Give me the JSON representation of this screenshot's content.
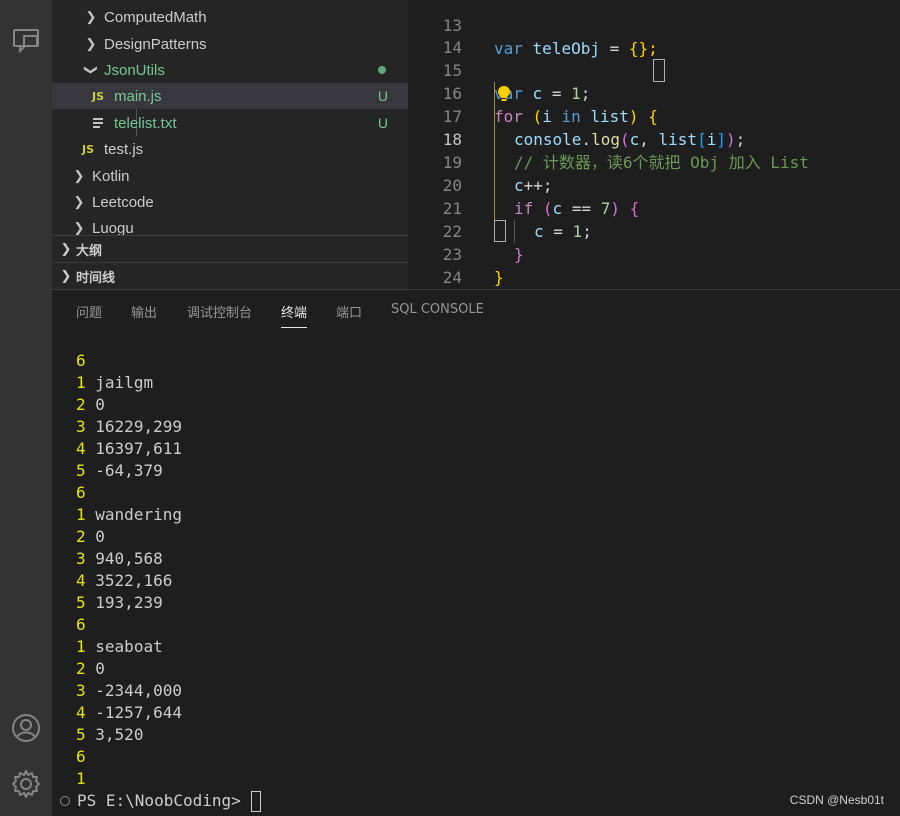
{
  "explorer": {
    "items": [
      {
        "label": "ComputedMath",
        "kind": "folder",
        "state": "collapsed"
      },
      {
        "label": "DesignPatterns",
        "kind": "folder",
        "state": "collapsed"
      },
      {
        "label": "JsonUtils",
        "kind": "folder",
        "state": "expanded"
      },
      {
        "label": "main.js",
        "kind": "js",
        "badge": "JS",
        "status": "U"
      },
      {
        "label": "telelist.txt",
        "kind": "txt",
        "status": "U"
      },
      {
        "label": "test.js",
        "kind": "js",
        "badge": "JS"
      },
      {
        "label": "Kotlin",
        "kind": "folder",
        "state": "collapsed"
      },
      {
        "label": "Leetcode",
        "kind": "folder",
        "state": "collapsed"
      },
      {
        "label": "Luogu",
        "kind": "folder",
        "state": "collapsed"
      }
    ],
    "outline_label": "大纲",
    "timeline_label": "时间线"
  },
  "editor": {
    "line_numbers": [
      "13",
      "14",
      "15",
      "16",
      "17",
      "18",
      "19",
      "20",
      "21",
      "22",
      "23",
      "24"
    ],
    "active_line": "18",
    "lines": {
      "l13": {
        "kw": "var",
        "name": "teleObj",
        "rest": " = ",
        "brace": "{};"
      },
      "l15": {
        "kw": "var",
        "name": "c",
        "rest": " = ",
        "num": "1",
        "end": ";"
      },
      "l16": {
        "kw": "for",
        "open": "(",
        "a": "i",
        "in": "in",
        "b": "list",
        "close": ")",
        "brace": "{"
      },
      "l17": {
        "obj": "console",
        "dot": ".",
        "fn": "log",
        "open": "(",
        "a": "c",
        "comma": ", ",
        "b": "list",
        "idx_open": "[",
        "idx": "i",
        "idx_close": "]",
        "close": ")",
        "end": ";"
      },
      "l18": {
        "comment": "// 计数器，读6个就把 Obj 加入 List"
      },
      "l19": {
        "a": "c",
        "op": "++",
        "end": ";"
      },
      "l20": {
        "kw": "if",
        "open": "(",
        "a": "c",
        "op": " == ",
        "num": "7",
        "close": ")",
        "brace": "{"
      },
      "l21": {
        "a": "c",
        "op": " = ",
        "num": "1",
        "end": ";"
      },
      "l22": {
        "brace": "}"
      },
      "l23": {
        "brace": "}"
      }
    }
  },
  "panel": {
    "tabs": [
      "问题",
      "输出",
      "调试控制台",
      "终端",
      "端口",
      "SQL CONSOLE"
    ],
    "active_tab": "终端",
    "terminal_lines": [
      {
        "n": "6",
        "t": ""
      },
      {
        "n": "1",
        "t": "jailgm"
      },
      {
        "n": "2",
        "t": "0"
      },
      {
        "n": "3",
        "t": "16229,299"
      },
      {
        "n": "4",
        "t": "16397,611"
      },
      {
        "n": "5",
        "t": "-64,379"
      },
      {
        "n": "6",
        "t": ""
      },
      {
        "n": "1",
        "t": "wandering"
      },
      {
        "n": "2",
        "t": "0"
      },
      {
        "n": "3",
        "t": "940,568"
      },
      {
        "n": "4",
        "t": "3522,166"
      },
      {
        "n": "5",
        "t": "193,239"
      },
      {
        "n": "6",
        "t": ""
      },
      {
        "n": "1",
        "t": "seaboat"
      },
      {
        "n": "2",
        "t": "0"
      },
      {
        "n": "3",
        "t": "-2344,000"
      },
      {
        "n": "4",
        "t": "-1257,644"
      },
      {
        "n": "5",
        "t": "3,520"
      },
      {
        "n": "6",
        "t": ""
      },
      {
        "n": "1",
        "t": ""
      }
    ],
    "prompt": "PS E:\\NoobCoding>",
    "watermark": "CSDN @Nesb01t"
  },
  "colors": {
    "accent_green": "#73c991",
    "terminal_number": "#e5e510",
    "keyword": "#569cd6",
    "comment": "#6a9955"
  },
  "icons": [
    "remote-explorer-icon",
    "account-icon",
    "settings-gear-icon",
    "chevron-right-icon",
    "chevron-down-icon",
    "text-file-icon",
    "lightbulb-icon"
  ]
}
